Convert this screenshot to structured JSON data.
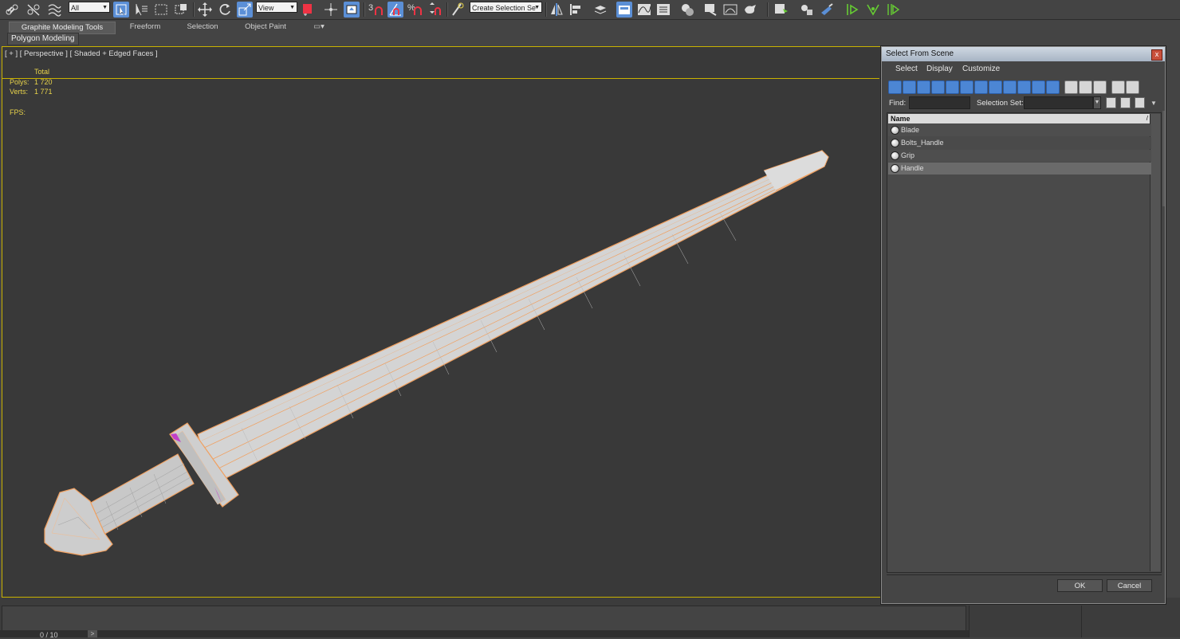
{
  "toolbar": {
    "filter_value": "All",
    "ref_coord_value": "View",
    "snap_label": "3",
    "named_selection_placeholder": "Create Selection Se"
  },
  "ribbon": {
    "tabs": [
      "Graphite Modeling Tools",
      "Freeform",
      "Selection",
      "Object Paint"
    ],
    "active_tab": "Graphite Modeling Tools",
    "subtab": "Polygon Modeling"
  },
  "viewport": {
    "label": "[ + ] [ Perspective ] [ Shaded + Edged Faces ]",
    "stats": {
      "total_header": "Total",
      "polys_label": "Polys:",
      "polys_value": "1 720",
      "verts_label": "Verts:",
      "verts_value": "1 771",
      "fps_label": "FPS:"
    }
  },
  "timeline": {
    "frame_counter": "0 / 10",
    "next_label": ">"
  },
  "dialog": {
    "title": "Select From Scene",
    "close_label": "x",
    "menu": [
      "Select",
      "Display",
      "Customize"
    ],
    "find_label": "Find:",
    "find_value": "",
    "selection_set_label": "Selection Set:",
    "selection_set_value": "",
    "column_header": "Name",
    "sort_indicator": "/",
    "items": [
      {
        "name": "Blade",
        "selected": false
      },
      {
        "name": "Bolts_Handle",
        "selected": false
      },
      {
        "name": "Grip",
        "selected": false
      },
      {
        "name": "Handle",
        "selected": true
      }
    ],
    "ok_label": "OK",
    "cancel_label": "Cancel"
  },
  "colors": {
    "viewport_bg": "#393939",
    "viewport_border": "#c9b200",
    "stats_text": "#e8d34a",
    "wire_color": "#f0a060",
    "mesh_color": "#d2d2d2",
    "accent_blue": "#5b8fd6",
    "selected_row": "#6a6a6a"
  }
}
